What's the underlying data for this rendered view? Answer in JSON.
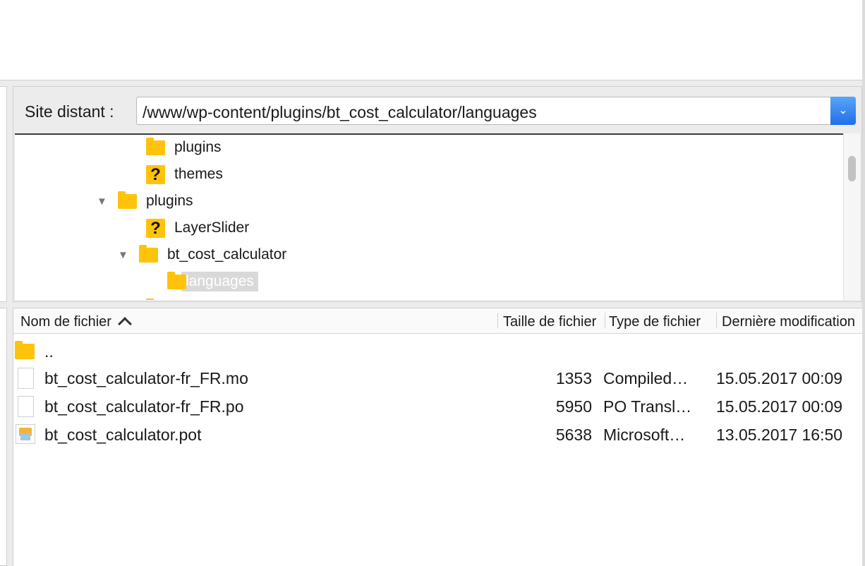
{
  "remote": {
    "label": "Site distant :",
    "path": "/www/wp-content/plugins/bt_cost_calculator/languages"
  },
  "tree": [
    {
      "label": "plugins",
      "icon": "folder-icon"
    },
    {
      "label": "themes",
      "icon": "unknown-folder-icon"
    },
    {
      "label": "plugins",
      "icon": "folder-icon",
      "expanded": true
    },
    {
      "label": "LayerSlider",
      "icon": "unknown-folder-icon"
    },
    {
      "label": "bt_cost_calculator",
      "icon": "folder-icon",
      "expanded": true
    },
    {
      "label": "languages",
      "icon": "folder-icon",
      "selected": true
    }
  ],
  "list": {
    "columns": [
      "Nom de fichier",
      "Taille de fichier",
      "Type de fichier",
      "Dernière modification"
    ],
    "rows": [
      {
        "name": "..",
        "size": "",
        "type": "",
        "modified": "",
        "icon": "parent-folder-icon"
      },
      {
        "name": "bt_cost_calculator-fr_FR.mo",
        "size": "1353",
        "type": "Compiled…",
        "modified": "15.05.2017 00:09",
        "icon": "file-icon"
      },
      {
        "name": "bt_cost_calculator-fr_FR.po",
        "size": "5950",
        "type": "PO Transl…",
        "modified": "15.05.2017 00:09",
        "icon": "file-icon"
      },
      {
        "name": "bt_cost_calculator.pot",
        "size": "5638",
        "type": "Microsoft…",
        "modified": "13.05.2017 16:50",
        "icon": "pot-file-icon"
      }
    ]
  },
  "colors": {
    "folder": "#ffc30b",
    "accent": "#2a7bf0",
    "selection": "#d9d9d9"
  }
}
